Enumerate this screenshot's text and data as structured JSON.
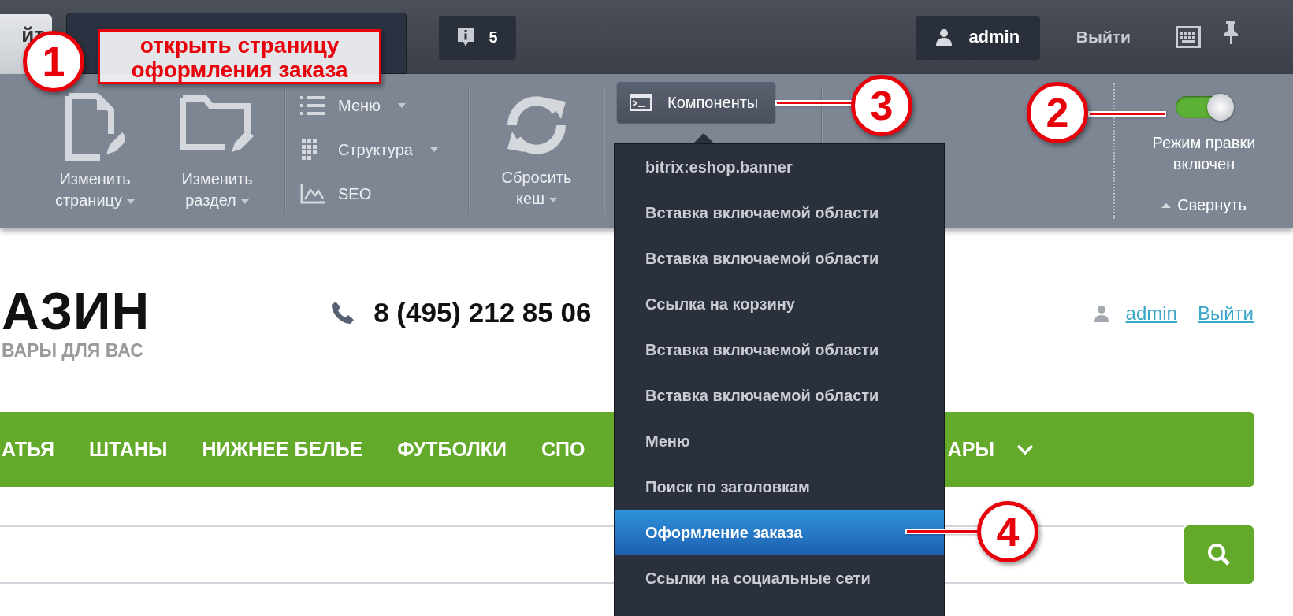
{
  "top_bar": {
    "site_tab": "йт",
    "notifications": "5",
    "user": "admin",
    "logout": "Выйти"
  },
  "toolbar": {
    "buttons": [
      {
        "label": "Изменить страницу",
        "dropdown": true
      },
      {
        "label": "Изменить раздел",
        "dropdown": true
      }
    ],
    "menu_items": [
      {
        "label": "Меню",
        "dropdown": true
      },
      {
        "label": "Структура",
        "dropdown": true
      },
      {
        "label": "SEO",
        "dropdown": false
      }
    ],
    "cache": {
      "label": "Сбросить кеш",
      "dropdown": true
    },
    "components": "Компоненты",
    "edit_mode": {
      "label": "Режим правки включен",
      "on": true
    },
    "collapse": "Свернуть"
  },
  "components_menu": [
    {
      "label": "bitrix:eshop.banner",
      "selected": false
    },
    {
      "label": "Вставка включаемой области",
      "selected": false
    },
    {
      "label": "Вставка включаемой области",
      "selected": false
    },
    {
      "label": "Ссылка на корзину",
      "selected": false
    },
    {
      "label": "Вставка включаемой области",
      "selected": false
    },
    {
      "label": "Вставка включаемой области",
      "selected": false
    },
    {
      "label": "Меню",
      "selected": false
    },
    {
      "label": "Поиск по заголовкам",
      "selected": false
    },
    {
      "label": "Оформление заказа",
      "selected": true
    },
    {
      "label": "Ссылки на социальные сети",
      "selected": false
    }
  ],
  "site": {
    "logo_title": "АЗИН",
    "logo_subtitle": "ВАРЫ ДЛЯ ВАС",
    "phone": "8 (495) 212 85 06",
    "user_link": "admin",
    "logout_link": "Выйти",
    "nav": [
      "АТЬЯ",
      "ШТАНЫ",
      "НИЖНЕЕ БЕЛЬЕ",
      "ФУТБОЛКИ",
      "СПО",
      "АРЫ"
    ]
  },
  "annotations": [
    {
      "number": "1",
      "text": "открыть страницу оформления заказа"
    },
    {
      "number": "2"
    },
    {
      "number": "3"
    },
    {
      "number": "4"
    }
  ]
}
